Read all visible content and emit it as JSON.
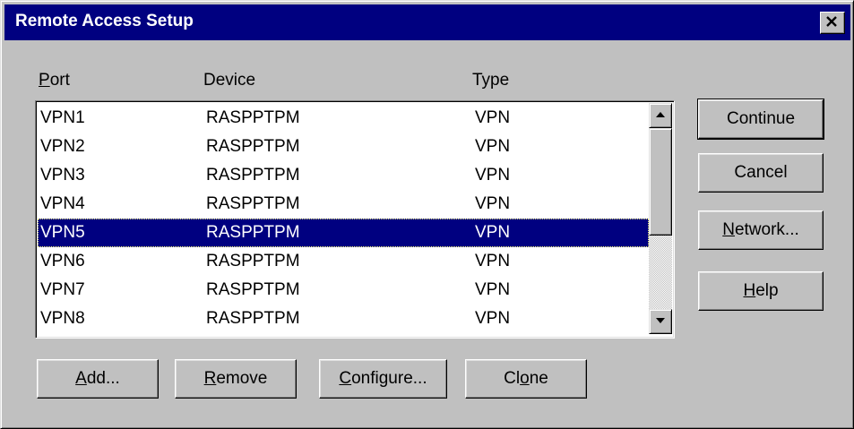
{
  "window": {
    "title": "Remote Access Setup"
  },
  "columns": {
    "port": "Port",
    "device": "Device",
    "type": "Type"
  },
  "rows": [
    {
      "port": "VPN1",
      "device": "RASPPTPM",
      "type": "VPN"
    },
    {
      "port": "VPN2",
      "device": "RASPPTPM",
      "type": "VPN"
    },
    {
      "port": "VPN3",
      "device": "RASPPTPM",
      "type": "VPN"
    },
    {
      "port": "VPN4",
      "device": "RASPPTPM",
      "type": "VPN"
    },
    {
      "port": "VPN5",
      "device": "RASPPTPM",
      "type": "VPN"
    },
    {
      "port": "VPN6",
      "device": "RASPPTPM",
      "type": "VPN"
    },
    {
      "port": "VPN7",
      "device": "RASPPTPM",
      "type": "VPN"
    },
    {
      "port": "VPN8",
      "device": "RASPPTPM",
      "type": "VPN"
    }
  ],
  "selected_row": "VPN5",
  "side_buttons": {
    "continue": "Continue",
    "cancel": "Cancel",
    "network": "Network...",
    "help": "Help"
  },
  "bottom_buttons": {
    "add": "Add...",
    "remove": "Remove",
    "configure": "Configure...",
    "clone": "Clone"
  },
  "icons": {
    "close": "close-icon",
    "scroll_up": "arrow-up-icon",
    "scroll_down": "arrow-down-icon"
  },
  "colors": {
    "titlebar": "#000080",
    "face": "#c0c0c0",
    "selection": "#000080"
  }
}
